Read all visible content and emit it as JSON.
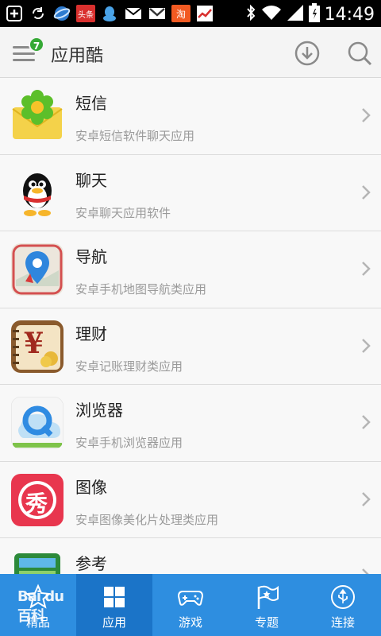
{
  "status_bar": {
    "time": "14:49",
    "left_icons": [
      "plus-icon",
      "sync-icon",
      "browser-icon",
      "toutiao-icon",
      "qq-icon",
      "mail-icon",
      "gmail-icon",
      "taobao-icon",
      "stocks-icon"
    ],
    "toutiao_label": "头条",
    "taobao_label": "淘",
    "right_icons": [
      "bluetooth-icon",
      "wifi-icon",
      "signal-icon",
      "battery-icon"
    ]
  },
  "header": {
    "title": "应用酷",
    "badge_count": "7",
    "icons": [
      "menu-icon",
      "download-icon",
      "search-icon"
    ]
  },
  "list": {
    "items": [
      {
        "title": "短信",
        "desc": "安卓短信软件聊天应用",
        "icon": "sms-flower-icon"
      },
      {
        "title": "聊天",
        "desc": "安卓聊天应用软件",
        "icon": "qq-penguin-icon"
      },
      {
        "title": "导航",
        "desc": "安卓手机地图导航类应用",
        "icon": "map-pin-icon"
      },
      {
        "title": "理财",
        "desc": "安卓记账理财类应用",
        "icon": "yen-notebook-icon"
      },
      {
        "title": "浏览器",
        "desc": "安卓手机浏览器应用",
        "icon": "browser-q-icon"
      },
      {
        "title": "图像",
        "desc": "安卓图像美化片处理类应用",
        "icon": "xiu-icon"
      },
      {
        "title": "参考",
        "desc": "",
        "icon": "reference-icon"
      }
    ],
    "xiu_char": "秀",
    "yen_char": "¥"
  },
  "bottom_nav": {
    "tabs": [
      {
        "label": "精品",
        "icon": "star-icon",
        "active": false
      },
      {
        "label": "应用",
        "icon": "grid-icon",
        "active": true
      },
      {
        "label": "游戏",
        "icon": "gamepad-icon",
        "active": false
      },
      {
        "label": "专题",
        "icon": "flag-icon",
        "active": false
      },
      {
        "label": "连接",
        "icon": "usb-icon",
        "active": false
      }
    ],
    "watermark": "Bai du 百科"
  },
  "colors": {
    "nav_bg": "#2e8ee0",
    "nav_active": "#1b74c8",
    "badge": "#35a935"
  }
}
